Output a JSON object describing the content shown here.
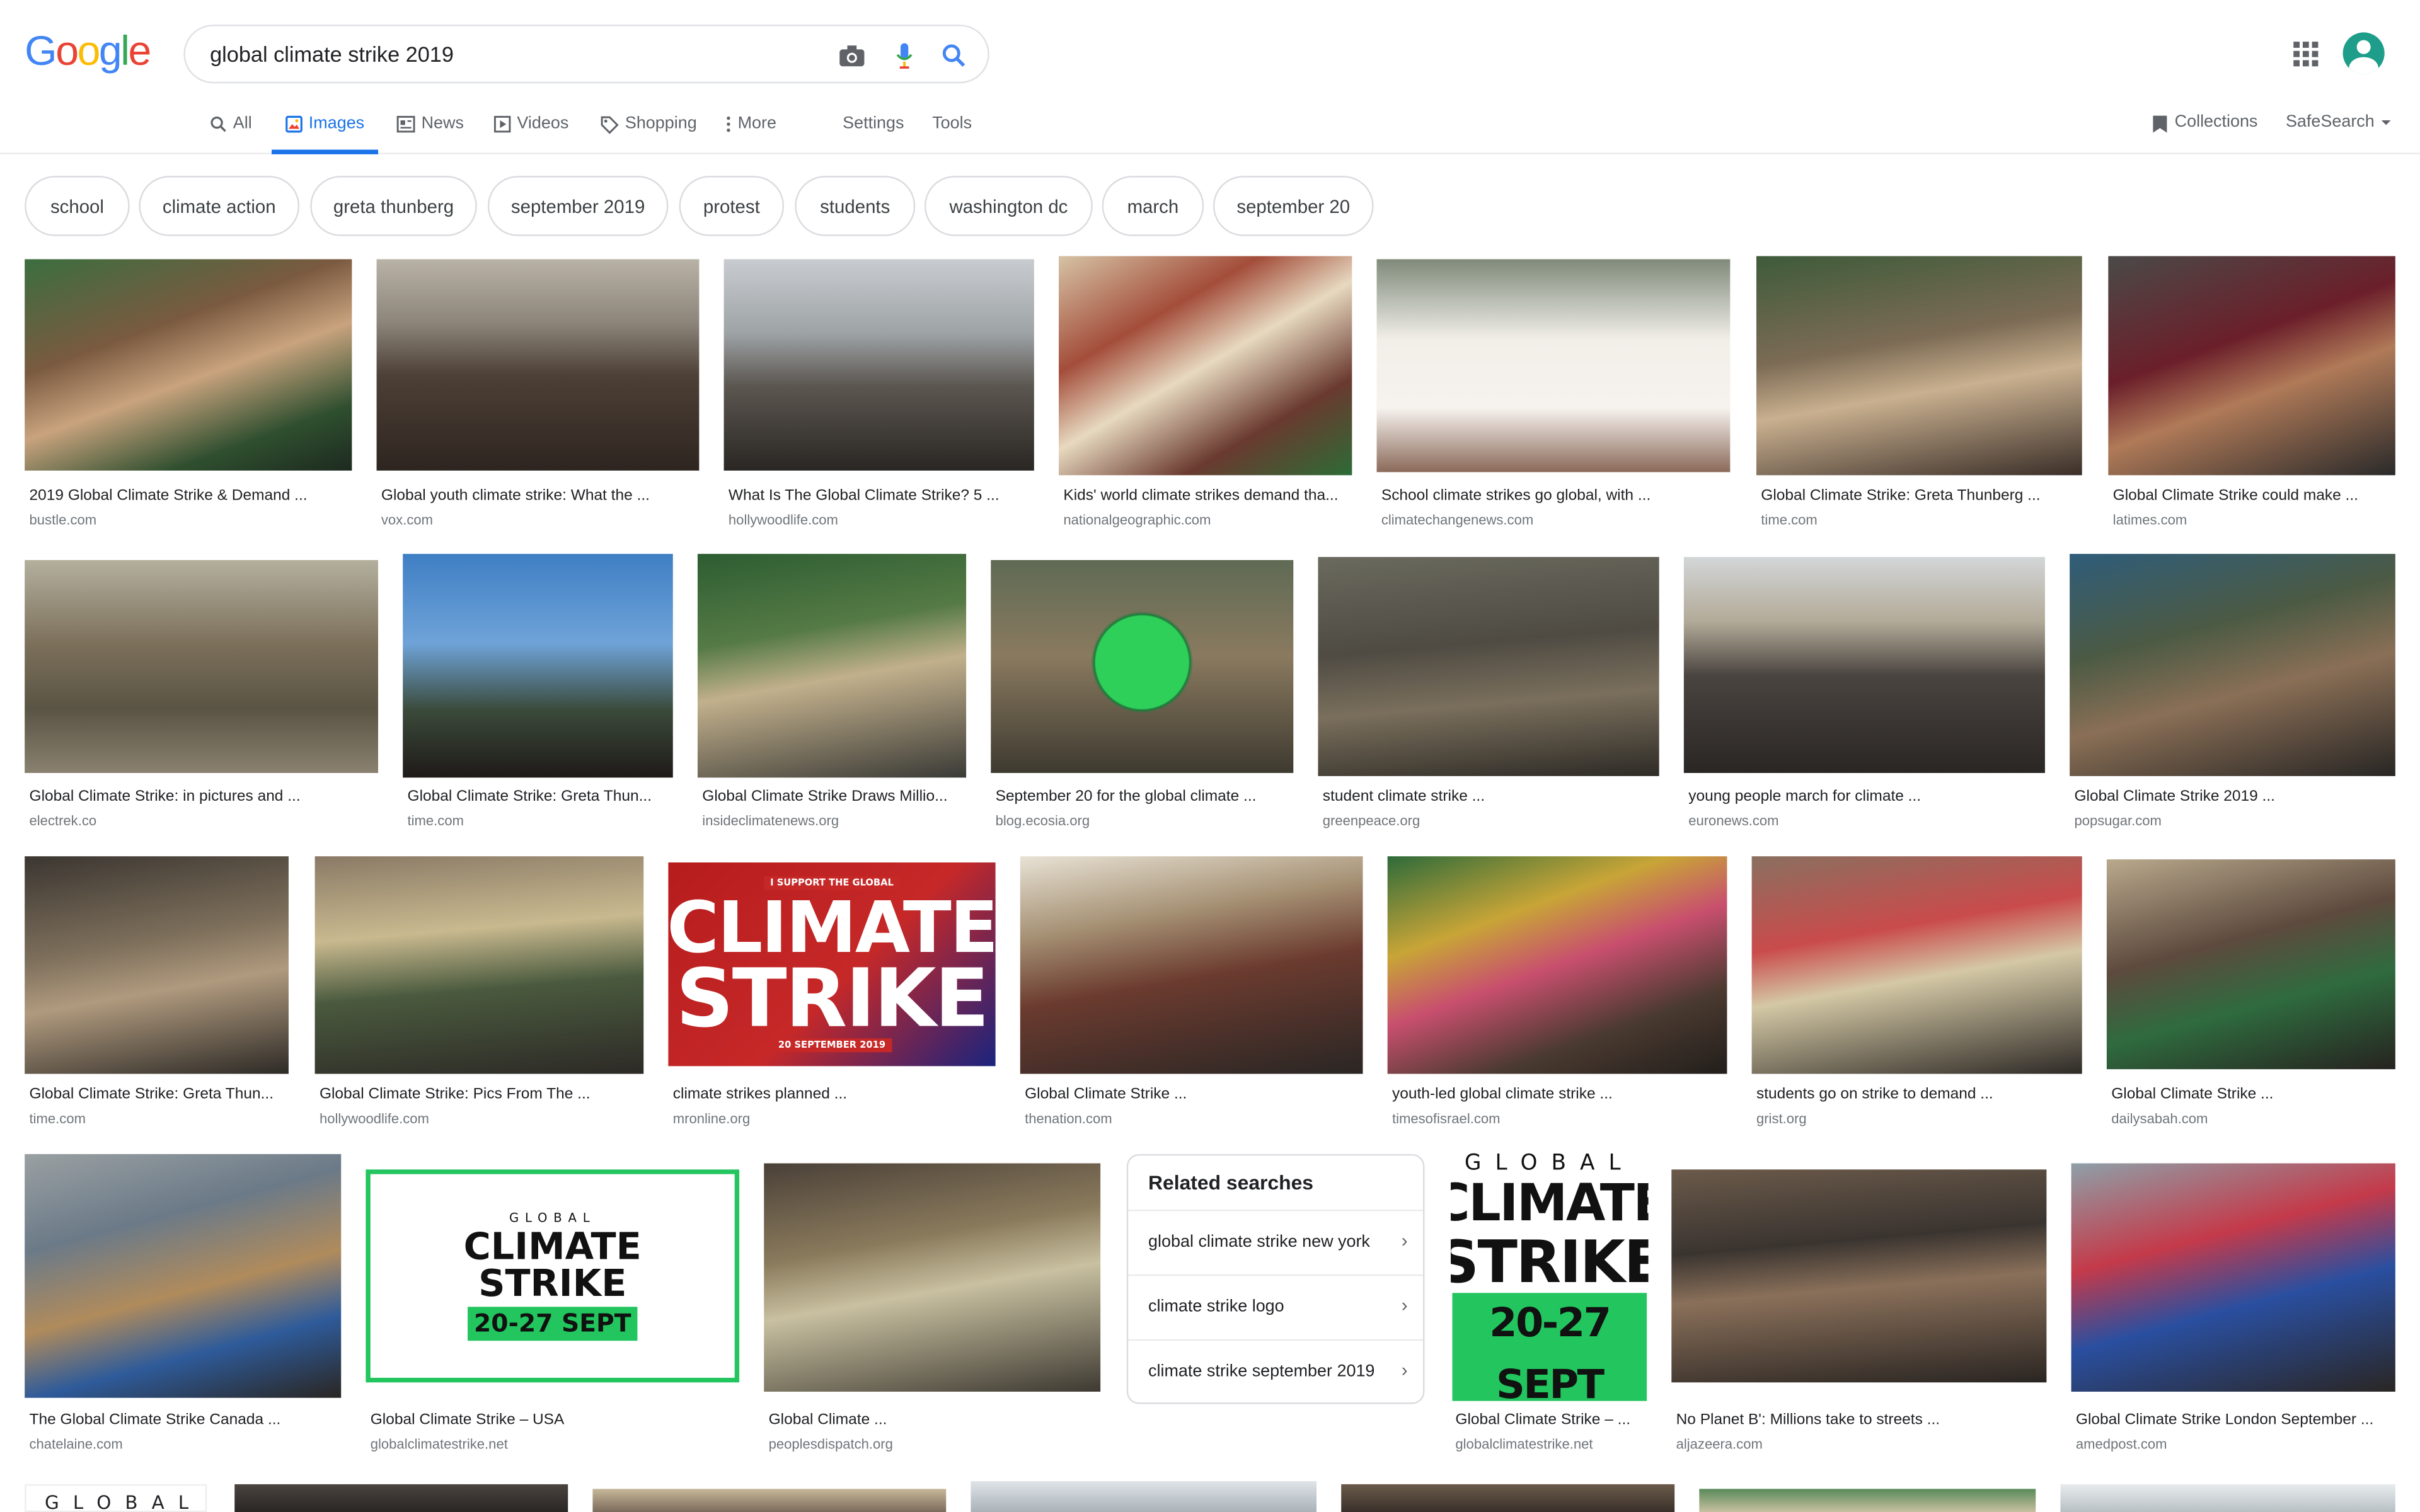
{
  "header": {
    "logo": [
      "G",
      "o",
      "o",
      "g",
      "l",
      "e"
    ],
    "logo_colors": [
      "#4285f4",
      "#ea4335",
      "#fbbc05",
      "#4285f4",
      "#34a853",
      "#ea4335"
    ],
    "query": "global climate strike 2019"
  },
  "tabs": {
    "all": "All",
    "images": "Images",
    "news": "News",
    "videos": "Videos",
    "shopping": "Shopping",
    "more": "More",
    "settings": "Settings",
    "tools": "Tools",
    "collections": "Collections",
    "safesearch": "SafeSearch"
  },
  "chips": [
    "school",
    "climate action",
    "greta thunberg",
    "september 2019",
    "protest",
    "students",
    "washington dc",
    "march",
    "september 20"
  ],
  "results": [
    {
      "caption": "2019 Global Climate Strike & Demand ...",
      "source": "bustle.com"
    },
    {
      "caption": "Global youth climate strike: What the ...",
      "source": "vox.com"
    },
    {
      "caption": "What Is The Global Climate Strike? 5 ...",
      "source": "hollywoodlife.com"
    },
    {
      "caption": "Kids' world climate strikes demand tha...",
      "source": "nationalgeographic.com"
    },
    {
      "caption": "School climate strikes go global, with ...",
      "source": "climatechangenews.com"
    },
    {
      "caption": "Global Climate Strike: Greta Thunberg ...",
      "source": "time.com"
    },
    {
      "caption": "Global Climate Strike could make ...",
      "source": "latimes.com"
    },
    {
      "caption": "Global Climate Strike: in pictures and ...",
      "source": "electrek.co"
    },
    {
      "caption": "Global Climate Strike: Greta Thun...",
      "source": "time.com"
    },
    {
      "caption": "Global Climate Strike Draws Millio...",
      "source": "insideclimatenews.org"
    },
    {
      "caption": "September 20 for the global climate ...",
      "source": "blog.ecosia.org"
    },
    {
      "caption": "student climate strike ...",
      "source": "greenpeace.org"
    },
    {
      "caption": "young people march for climate ...",
      "source": "euronews.com"
    },
    {
      "caption": "Global Climate Strike 2019 ...",
      "source": "popsugar.com"
    },
    {
      "caption": "Global Climate Strike: Greta Thun...",
      "source": "time.com"
    },
    {
      "caption": "Global Climate Strike: Pics From The ...",
      "source": "hollywoodlife.com"
    },
    {
      "caption": "climate strikes planned ...",
      "source": "mronline.org"
    },
    {
      "caption": "Global Climate Strike ...",
      "source": "thenation.com"
    },
    {
      "caption": "youth-led global climate strike ...",
      "source": "timesofisrael.com"
    },
    {
      "caption": "students go on strike to demand ...",
      "source": "grist.org"
    },
    {
      "caption": "Global Climate Strike ...",
      "source": "dailysabah.com"
    },
    {
      "caption": "The Global Climate Strike Canada ...",
      "source": "chatelaine.com"
    },
    {
      "caption": "Global Climate Strike – USA",
      "source": "globalclimatestrike.net"
    },
    {
      "caption": "Global Climate ...",
      "source": "peoplesdispatch.org"
    },
    {
      "caption": "Global Climate Strike – ...",
      "source": "globalclimatestrike.net"
    },
    {
      "caption": "No Planet B': Millions take to streets ...",
      "source": "aljazeera.com"
    },
    {
      "caption": "Global Climate Strike London September ...",
      "source": "amedpost.com"
    }
  ],
  "related": {
    "title": "Related searches",
    "items": [
      "global climate strike new york",
      "climate strike logo",
      "climate strike september 2019"
    ]
  },
  "posters": {
    "strike_banner_top": "I SUPPORT THE GLOBAL",
    "strike_banner_line1": "CLIMATE",
    "strike_banner_line2": "STRIKE",
    "strike_banner_date": "20 SEPTEMBER 2019",
    "usa_global": "GLOBAL",
    "usa_climate": "CLIMATE",
    "usa_strike": "STRIKE",
    "usa_dates": "20-27 SEPT",
    "big_global": "GLOBAL",
    "big_climate": "CLIMATE",
    "big_strike": "STRIKE",
    "big_dates": "20-27 SEPT",
    "bottom_global": "GLOBAL"
  },
  "colors": {
    "accent": "#1a73e8",
    "poster_green": "#22c55e",
    "poster_red": "#c62828"
  }
}
